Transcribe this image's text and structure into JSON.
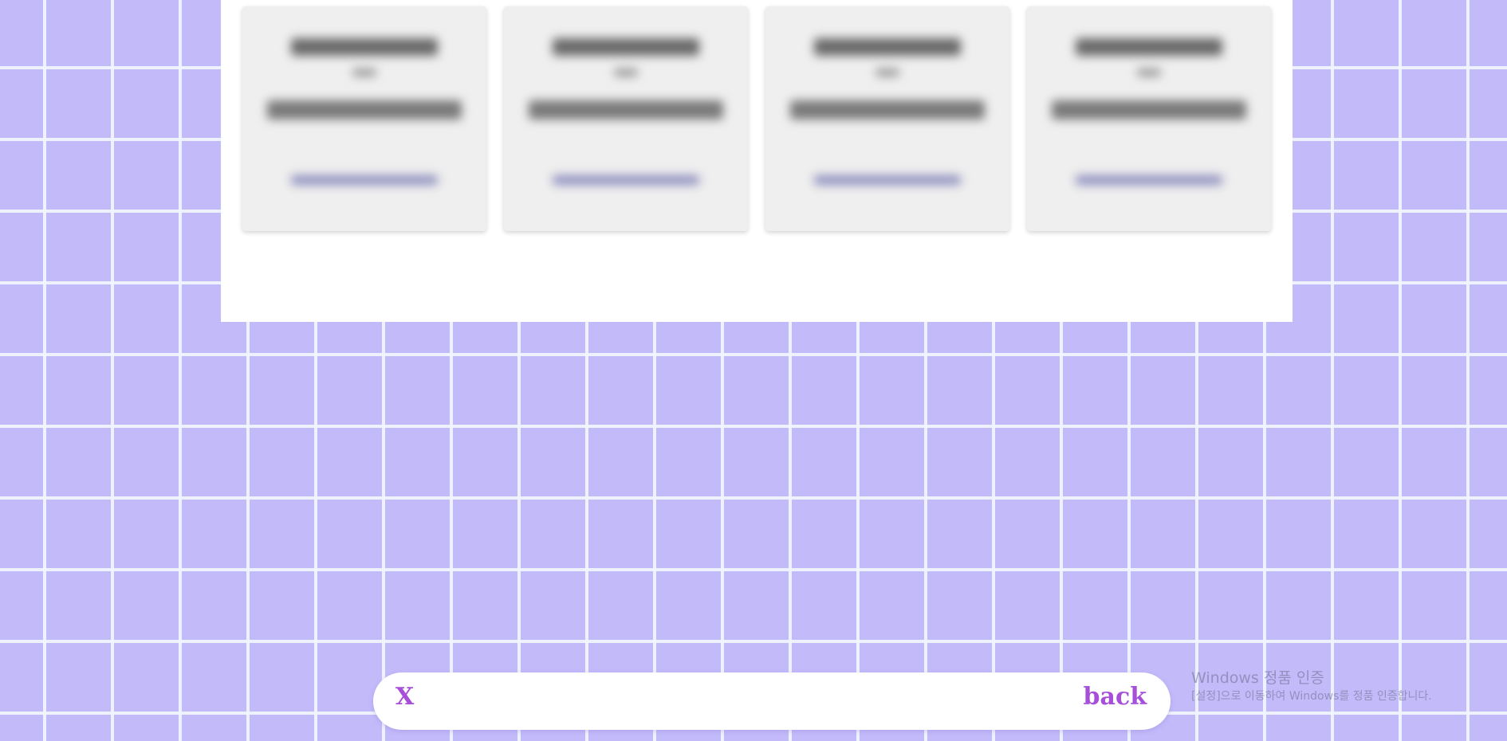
{
  "bottom_bar": {
    "close_label": "X",
    "back_label": "back"
  },
  "watermark": {
    "title": "Windows 정품 인증",
    "subtitle": "[설정]으로 이동하여 Windows를 정품 인증합니다."
  },
  "colors": {
    "background": "#c3bafa",
    "grid_line": "#f0f6ff",
    "accent": "#a64fd8",
    "card": "#efefef"
  }
}
